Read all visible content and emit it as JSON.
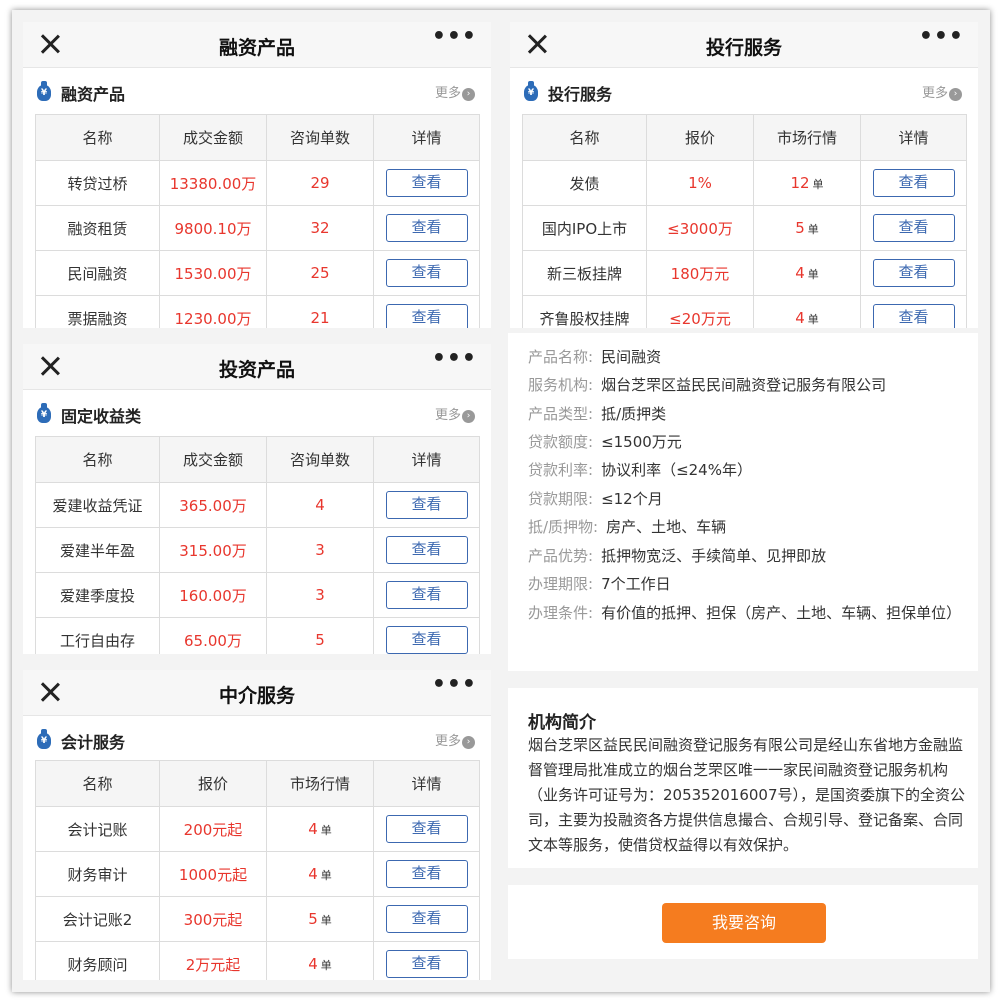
{
  "financing": {
    "title": "融资产品",
    "section_title": "融资产品",
    "more": "更多",
    "headers": [
      "名称",
      "成交金额",
      "咨询单数",
      "详情"
    ],
    "rows": [
      {
        "name": "转贷过桥",
        "amount": "13380.00万",
        "count": "29",
        "detail": "查看"
      },
      {
        "name": "融资租赁",
        "amount": "9800.10万",
        "count": "32",
        "detail": "查看"
      },
      {
        "name": "民间融资",
        "amount": "1530.00万",
        "count": "25",
        "detail": "查看"
      },
      {
        "name": "票据融资",
        "amount": "1230.00万",
        "count": "21",
        "detail": "查看"
      }
    ]
  },
  "investbank": {
    "title": "投行服务",
    "section_title": "投行服务",
    "more": "更多",
    "headers": [
      "名称",
      "报价",
      "市场行情",
      "详情"
    ],
    "rows": [
      {
        "name": "发债",
        "price": "1%",
        "market": "12",
        "unit": "单",
        "detail": "查看"
      },
      {
        "name": "国内IPO上市",
        "price": "≤3000万",
        "market": "5",
        "unit": "单",
        "detail": "查看"
      },
      {
        "name": "新三板挂牌",
        "price": "180万元",
        "market": "4",
        "unit": "单",
        "detail": "查看"
      },
      {
        "name": "齐鲁股权挂牌",
        "price": "≤20万元",
        "market": "4",
        "unit": "单",
        "detail": "查看"
      }
    ]
  },
  "investment": {
    "title": "投资产品",
    "section_title": "固定收益类",
    "more": "更多",
    "headers": [
      "名称",
      "成交金额",
      "咨询单数",
      "详情"
    ],
    "rows": [
      {
        "name": "爱建收益凭证",
        "amount": "365.00万",
        "count": "4",
        "detail": "查看"
      },
      {
        "name": "爱建半年盈",
        "amount": "315.00万",
        "count": "3",
        "detail": "查看"
      },
      {
        "name": "爱建季度投",
        "amount": "160.00万",
        "count": "3",
        "detail": "查看"
      },
      {
        "name": "工行自由存",
        "amount": "65.00万",
        "count": "5",
        "detail": "查看"
      }
    ]
  },
  "intermediary": {
    "title": "中介服务",
    "section_title": "会计服务",
    "more": "更多",
    "headers": [
      "名称",
      "报价",
      "市场行情",
      "详情"
    ],
    "rows": [
      {
        "name": "会计记账",
        "price": "200元起",
        "market": "4",
        "unit": "单",
        "detail": "查看"
      },
      {
        "name": "财务审计",
        "price": "1000元起",
        "market": "4",
        "unit": "单",
        "detail": "查看"
      },
      {
        "name": "会计记账2",
        "price": "300元起",
        "market": "5",
        "unit": "单",
        "detail": "查看"
      },
      {
        "name": "财务顾问",
        "price": "2万元起",
        "market": "4",
        "unit": "单",
        "detail": "查看"
      }
    ]
  },
  "product_detail": {
    "fields": [
      {
        "label": "产品名称:",
        "value": "民间融资"
      },
      {
        "label": "服务机构:",
        "value": "烟台芝罘区益民民间融资登记服务有限公司"
      },
      {
        "label": "产品类型:",
        "value": "抵/质押类"
      },
      {
        "label": "贷款额度:",
        "value": "≤1500万元"
      },
      {
        "label": "贷款利率:",
        "value": "协议利率（≤24%年）"
      },
      {
        "label": "贷款期限:",
        "value": "≤12个月"
      },
      {
        "label": "抵/质押物:",
        "value": "房产、土地、车辆"
      },
      {
        "label": "产品优势:",
        "value": "抵押物宽泛、手续简单、见押即放"
      },
      {
        "label": "办理期限:",
        "value": "7个工作日"
      },
      {
        "label": "办理条件:",
        "value": "有价值的抵押、担保（房产、土地、车辆、担保单位）"
      }
    ]
  },
  "institution": {
    "title": "机构简介",
    "text": "烟台芝罘区益民民间融资登记服务有限公司是经山东省地方金融监督管理局批准成立的烟台芝罘区唯一一家民间融资登记服务机构（业务许可证号为：205352016007号），是国资委旗下的全资公司，主要为投融资各方提供信息撮合、合规引导、登记备案、合同文本等服务，使借贷权益得以有效保护。"
  },
  "consult_button": "我要咨询",
  "colors": {
    "accent_red": "#e8362d",
    "button_blue": "#3c68b0",
    "consult_orange": "#f57c1f"
  },
  "icons": [
    "close-icon",
    "more-dots-icon",
    "money-bag-icon",
    "chevron-right-icon"
  ]
}
